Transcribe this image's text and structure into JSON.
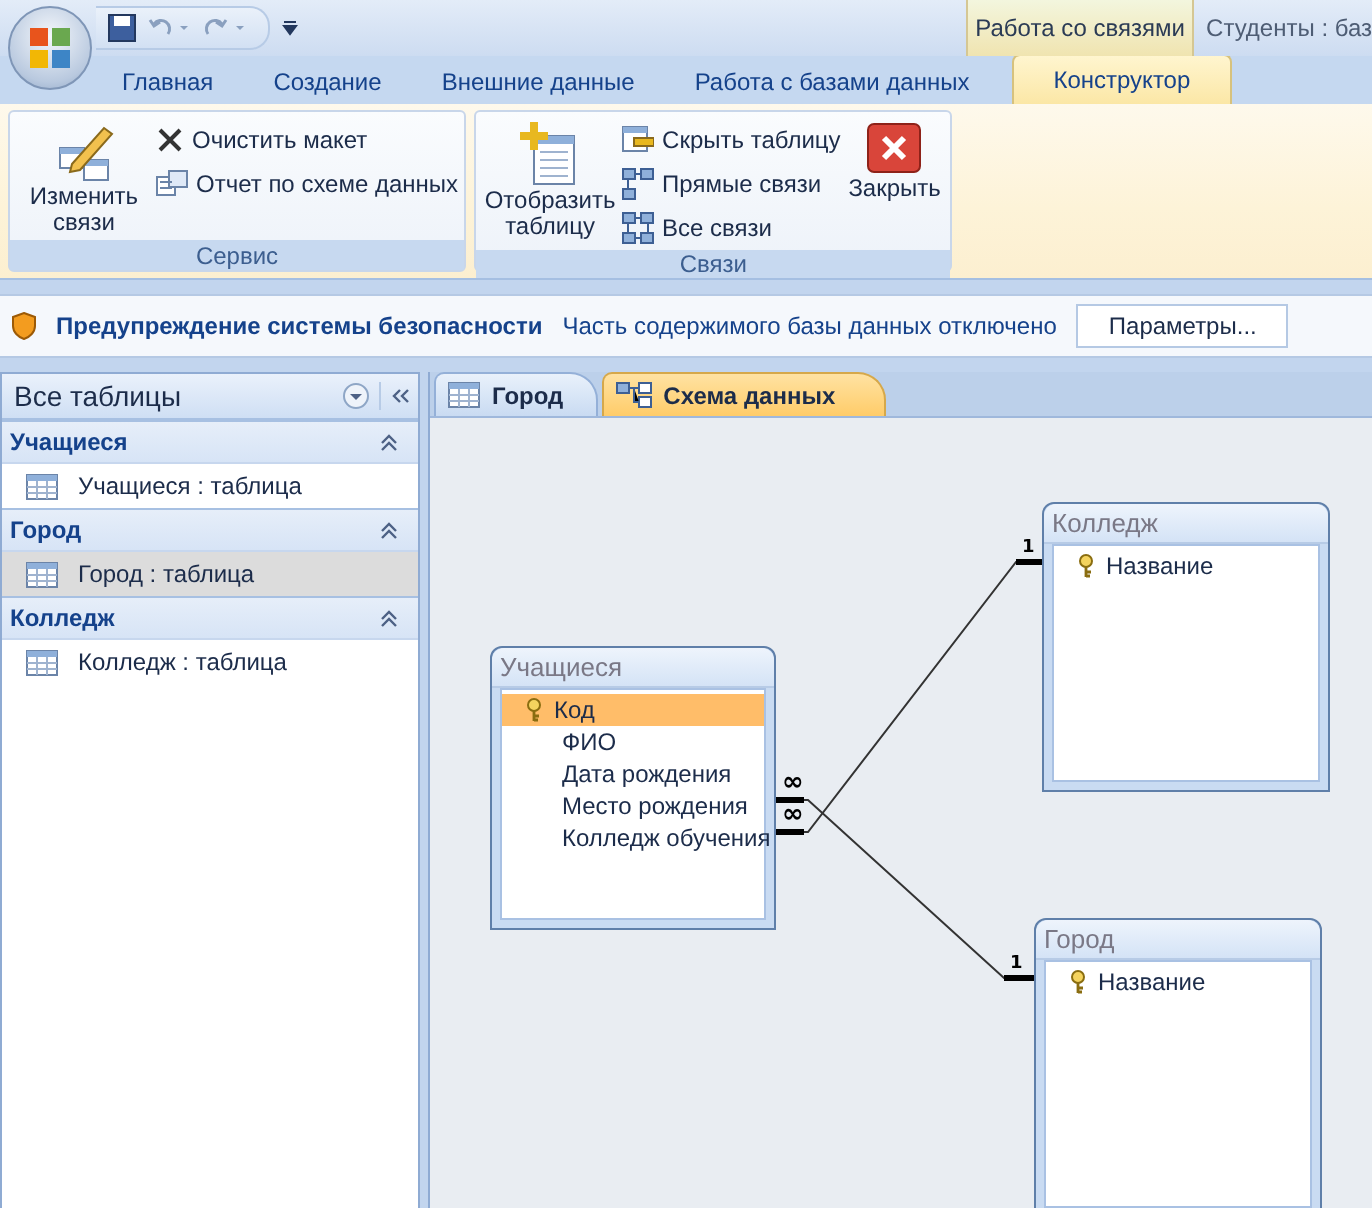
{
  "title_bar": {
    "context_group": "Работа со связями",
    "title": "Студенты : баз"
  },
  "ribbon_tabs": [
    {
      "label": "Главная",
      "selected": false
    },
    {
      "label": "Создание",
      "selected": false
    },
    {
      "label": "Внешние данные",
      "selected": false
    },
    {
      "label": "Работа с базами данных",
      "selected": false
    },
    {
      "label": "Конструктор",
      "selected": true
    }
  ],
  "ribbon_groups": [
    {
      "label": "Сервис",
      "items": [
        {
          "kind": "large",
          "label": "Изменить связи"
        },
        {
          "kind": "small",
          "label": "Очистить макет"
        },
        {
          "kind": "small",
          "label": "Отчет по схеме данных"
        }
      ]
    },
    {
      "label": "Связи",
      "items": [
        {
          "kind": "large",
          "label": "Отобразить таблицу"
        },
        {
          "kind": "small",
          "label": "Скрыть таблицу"
        },
        {
          "kind": "small",
          "label": "Прямые связи"
        },
        {
          "kind": "small",
          "label": "Все связи"
        },
        {
          "kind": "large",
          "label": "Закрыть"
        }
      ]
    }
  ],
  "security_bar": {
    "title": "Предупреждение системы безопасности",
    "message": "Часть содержимого базы данных отключено",
    "button": "Параметры..."
  },
  "nav_pane": {
    "header": "Все таблицы",
    "groups": [
      {
        "name": "Учащиеся",
        "expanded": true,
        "items": [
          {
            "label": "Учащиеся : таблица",
            "selected": false
          }
        ]
      },
      {
        "name": "Город",
        "expanded": true,
        "items": [
          {
            "label": "Город : таблица",
            "selected": true
          }
        ]
      },
      {
        "name": "Колледж",
        "expanded": true,
        "items": [
          {
            "label": "Колледж : таблица",
            "selected": false
          }
        ]
      }
    ]
  },
  "doc_tabs": [
    {
      "kind": "table",
      "label": "Город",
      "selected": false
    },
    {
      "kind": "diagram",
      "label": "Схема данных",
      "selected": true
    }
  ],
  "diagram": {
    "tables": [
      {
        "name": "Учащиеся",
        "fields": [
          {
            "name": "Код",
            "primary_key": true,
            "selected": true
          },
          {
            "name": "ФИО",
            "primary_key": false,
            "selected": false
          },
          {
            "name": "Дата рождения",
            "primary_key": false,
            "selected": false
          },
          {
            "name": "Место рождения",
            "primary_key": false,
            "selected": false
          },
          {
            "name": "Колледж обучения",
            "primary_key": false,
            "selected": false
          }
        ]
      },
      {
        "name": "Колледж",
        "fields": [
          {
            "name": "Название",
            "primary_key": true,
            "selected": false
          }
        ]
      },
      {
        "name": "Город",
        "fields": [
          {
            "name": "Название",
            "primary_key": true,
            "selected": false
          }
        ]
      }
    ],
    "relations": [
      {
        "many_label": "∞",
        "one_label": "1"
      },
      {
        "many_label": "∞",
        "one_label": "1"
      }
    ]
  }
}
